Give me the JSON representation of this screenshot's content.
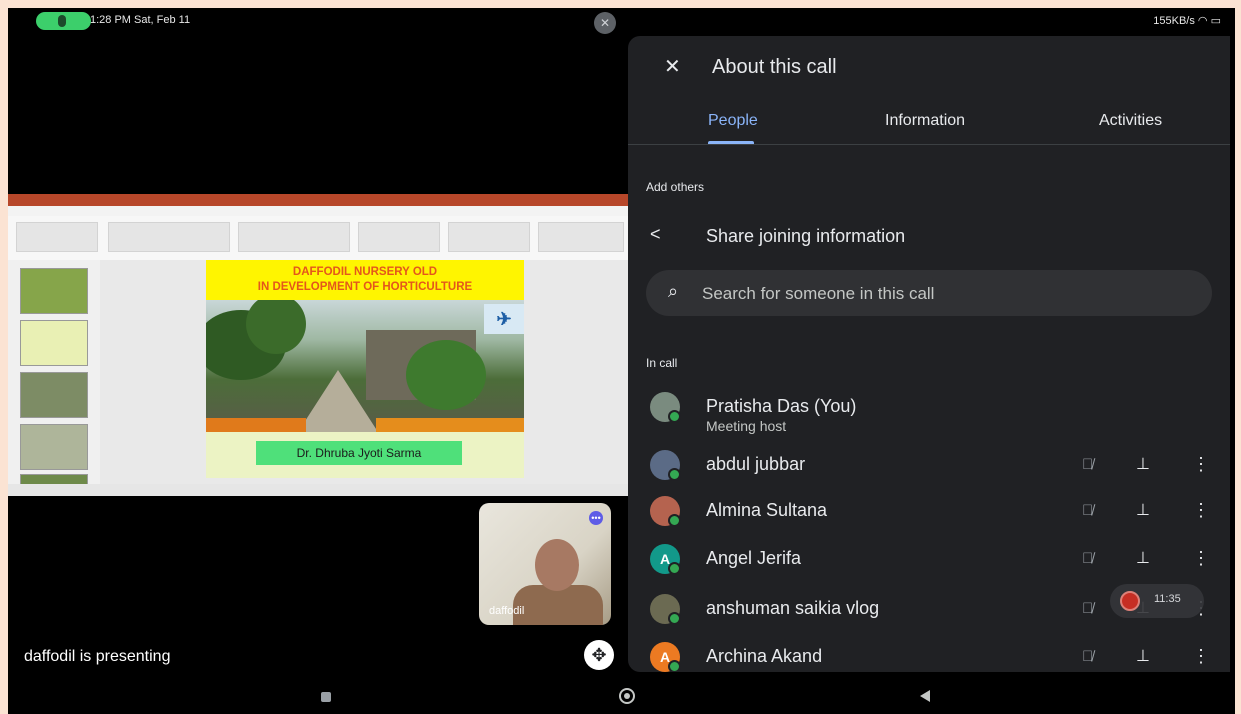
{
  "status_bar": {
    "time_date": "1:28 PM Sat, Feb 11",
    "network": "155KB/s"
  },
  "shared_screen": {
    "slide_title_line1": "DAFFODIL NURSERY OLD",
    "slide_title_line2": "IN DEVELOPMENT OF HORTICULTURE",
    "slide_author": "Dr. Dhruba Jyoti Sarma"
  },
  "self_view": {
    "name": "daffodil"
  },
  "presenting_text": "daffodil is presenting",
  "panel": {
    "title": "About this call",
    "tabs": [
      {
        "label": "People"
      },
      {
        "label": "Information"
      },
      {
        "label": "Activities"
      }
    ],
    "add_others_label": "Add others",
    "share_label": "Share joining information",
    "search_placeholder": "Search for someone in this call",
    "in_call_label": "In call",
    "participants": [
      {
        "name": "Pratisha Das (You)",
        "subtitle": "Meeting host",
        "avatar_color": "#7a8b7f"
      },
      {
        "name": "abdul jubbar",
        "avatar_color": "#5b6b86"
      },
      {
        "name": "Almina Sultana",
        "avatar_color": "#b5634f"
      },
      {
        "name": "Angel Jerifa",
        "initial": "A",
        "avatar_color": "#12998a"
      },
      {
        "name": "anshuman saikia vlog",
        "avatar_color": "#6b6a52"
      },
      {
        "name": "Archina Akand",
        "initial": "A",
        "avatar_color": "#ec7a22"
      }
    ],
    "recording_time": "11:35"
  }
}
